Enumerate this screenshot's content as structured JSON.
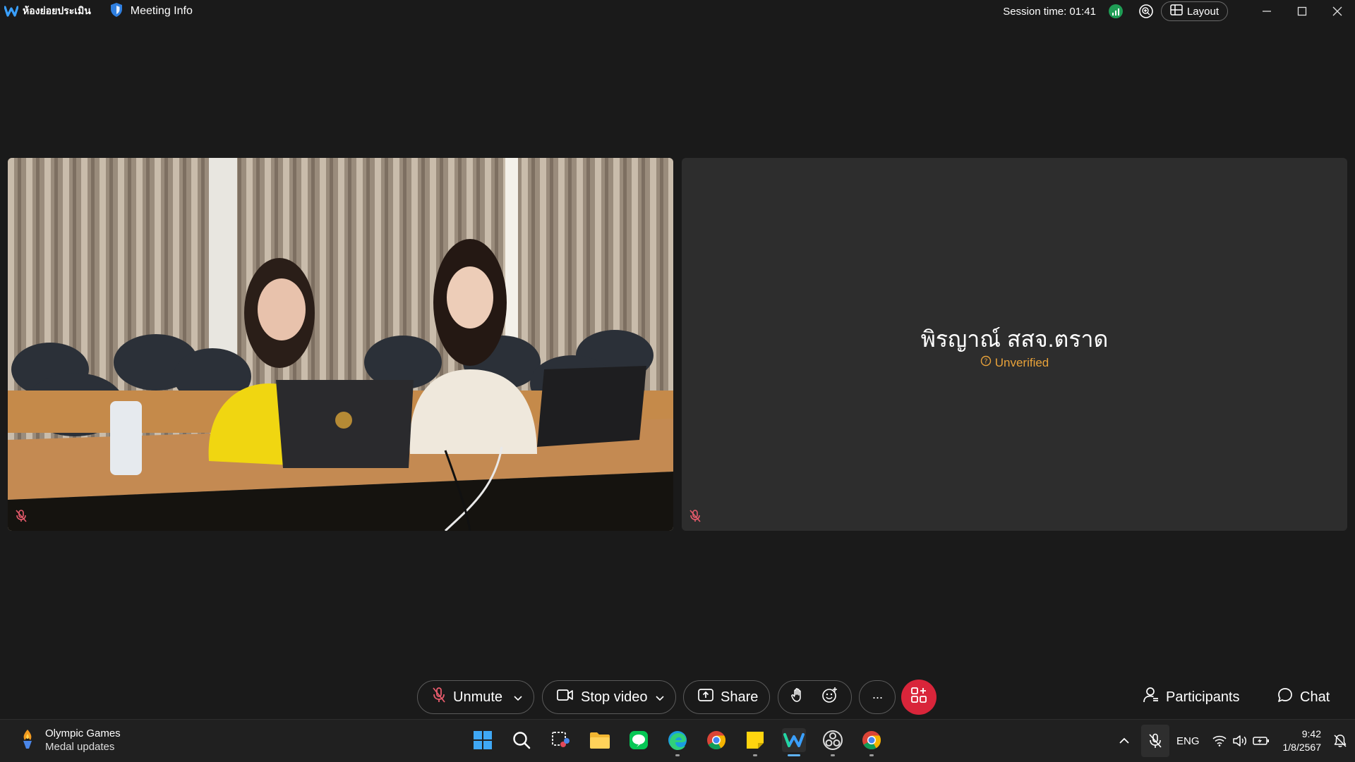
{
  "titlebar": {
    "room_name": "ห้องย่อยประเมิน",
    "meeting_info_label": "Meeting Info",
    "session_time": "Session time: 01:41",
    "layout_label": "Layout"
  },
  "video": {
    "remote_name": "พิรญาณ์ สสจ.ตราด",
    "remote_status": "Unverified"
  },
  "controls": {
    "unmute_label": "Unmute",
    "stop_video_label": "Stop video",
    "share_label": "Share",
    "more_label": "···",
    "participants_label": "Participants",
    "chat_label": "Chat"
  },
  "taskbar": {
    "widget_title": "Olympic Games",
    "widget_subtitle": "Medal updates",
    "language": "ENG",
    "time": "9:42",
    "date": "1/8/2567"
  },
  "colors": {
    "background": "#1a1a1a",
    "apps_button": "#d9253a",
    "unverified": "#e8a23a",
    "accent": "#5fb2f2"
  }
}
